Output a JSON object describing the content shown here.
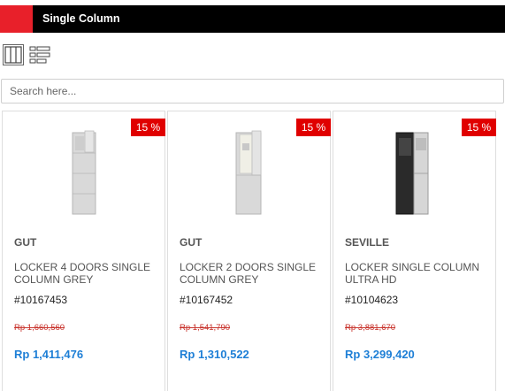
{
  "header": {
    "title": "Single Column",
    "accent_color": "#e8202a"
  },
  "view_controls": {
    "grid_icon": "grid-view-icon",
    "list_icon": "list-view-icon"
  },
  "search": {
    "placeholder": "Search here...",
    "value": ""
  },
  "products": [
    {
      "badge": "15 %",
      "brand": "GUT",
      "name": "LOCKER 4 DOORS SINGLE COLUMN GREY",
      "sku": "#10167453",
      "old_price": "Rp 1,660,560",
      "price": "Rp 1,411,476",
      "image_icon": "grey-locker-4-doors-image"
    },
    {
      "badge": "15 %",
      "brand": "GUT",
      "name": "LOCKER 2 DOORS SINGLE COLUMN GREY",
      "sku": "#10167452",
      "old_price": "Rp 1,541,790",
      "price": "Rp 1,310,522",
      "image_icon": "grey-locker-2-doors-image"
    },
    {
      "badge": "15 %",
      "brand": "SEVILLE",
      "name": "LOCKER SINGLE COLUMN ULTRA HD",
      "sku": "#10104623",
      "old_price": "Rp 3,881,670",
      "price": "Rp 3,299,420",
      "image_icon": "dark-locker-ultra-hd-image"
    }
  ]
}
